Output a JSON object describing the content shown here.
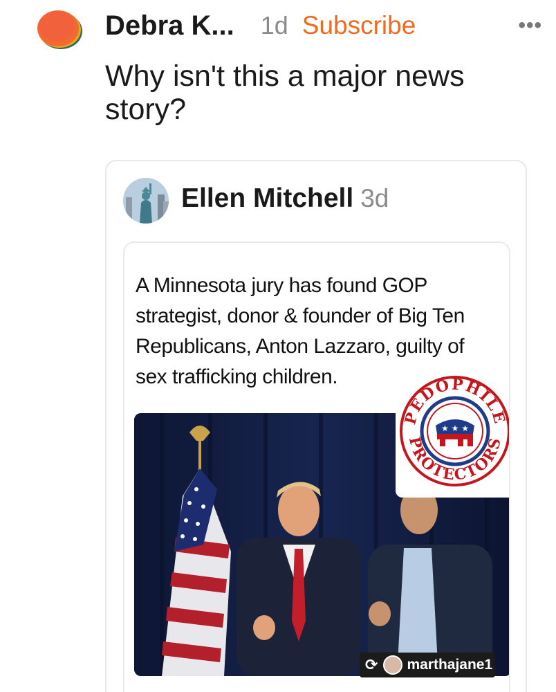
{
  "comment": {
    "author": "Debra K...",
    "time": "1d",
    "subscribe_label": "Subscribe",
    "more_label": "•••",
    "text": "Why isn't this a major news story?"
  },
  "quoted_post": {
    "author": "Ellen Mitchell",
    "time": "3d",
    "tweet_text": "A Minnesota jury has found GOP\nstrategist, donor & founder of Big Ten\nRepublicans, Anton Lazzaro, guilty of\nsex trafficking children.",
    "badge_top_text": "PEDOPHILE",
    "badge_bottom_text": "PROTECTORS",
    "handle": "marthajane1"
  },
  "colors": {
    "accent": "#f06a1f",
    "muted": "#8a8a8a",
    "badge_red": "#c4161c",
    "badge_blue": "#1f3c88"
  }
}
